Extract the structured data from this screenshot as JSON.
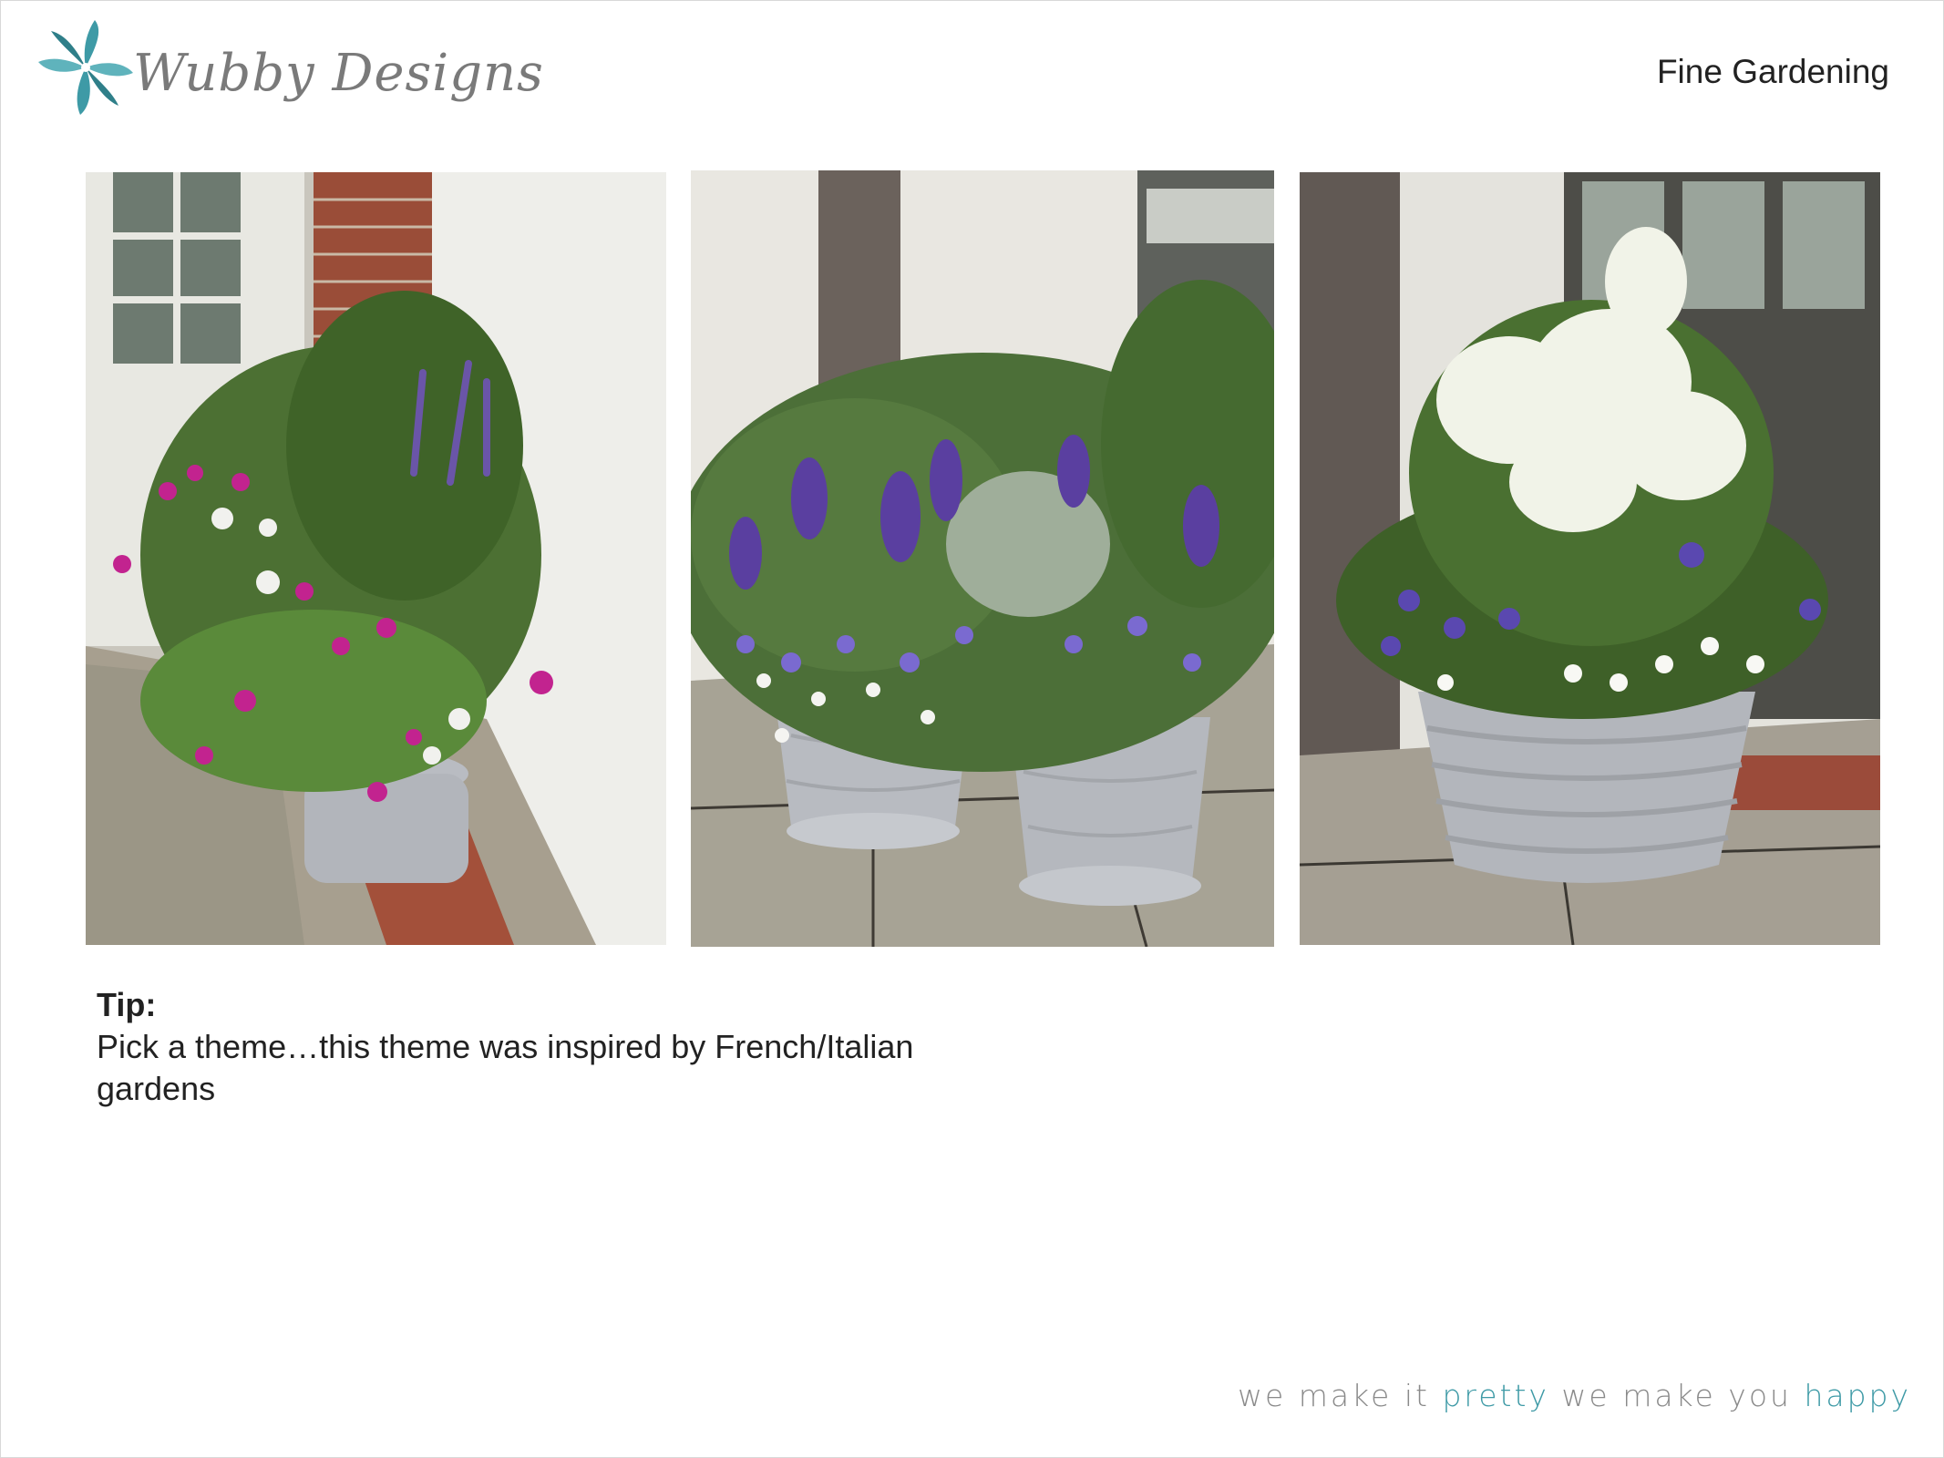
{
  "brand": {
    "name": "Wubby Designs",
    "accent_color": "#3e9aa6"
  },
  "header": {
    "title": "Fine Gardening"
  },
  "photos": [
    {
      "icon": "planter-corner-pink-verbena-photo"
    },
    {
      "icon": "planter-pair-purple-lavender-photo"
    },
    {
      "icon": "planter-white-hydrangea-photo"
    }
  ],
  "tip": {
    "heading": "Tip:",
    "body": "Pick a theme…this theme was inspired by French/Italian gardens"
  },
  "footer": {
    "tagline_part1": "we make it ",
    "tagline_accent1": "pretty",
    "tagline_part2": " we make you ",
    "tagline_accent2": "happy"
  }
}
